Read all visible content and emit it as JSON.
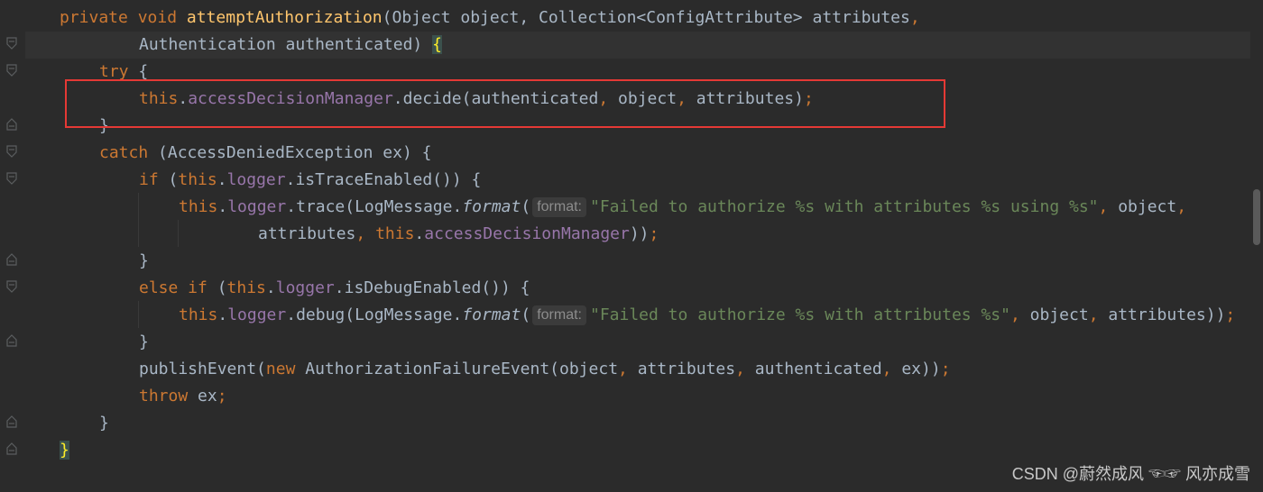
{
  "code": {
    "sig_private": "private",
    "sig_void": "void",
    "sig_method": "attemptAuthorization",
    "sig_params1": "(Object object, Collection<ConfigAttribute> attributes",
    "sig_comma": ",",
    "sig_params2": "Authentication authenticated) ",
    "sig_brace": "{",
    "try_kw": "try",
    "try_brace": " {",
    "decide_this": "this",
    "decide_dot": ".",
    "decide_field": "accessDecisionManager",
    "decide_call": ".decide(authenticated",
    "decide_c1": ",",
    "decide_obj": " object",
    "decide_c2": ",",
    "decide_attr": " attributes)",
    "decide_semi": ";",
    "close_try": "}",
    "catch_kw": "catch",
    "catch_rest": " (AccessDeniedException ex) {",
    "if_kw": "if",
    "if_open": " (",
    "if_this": "this",
    "if_dot": ".",
    "if_logger": "logger",
    "if_rest": ".isTraceEnabled()) {",
    "trace_this": "this",
    "trace_dot": ".",
    "trace_logger": "logger",
    "trace_call": ".trace(LogMessage.",
    "trace_format": "format",
    "trace_paren": "(",
    "trace_hint": "format:",
    "trace_str": "\"Failed to authorize %s with attributes %s using %s\"",
    "trace_c1": ",",
    "trace_obj": " object",
    "trace_c2": ",",
    "trace2_attr": "attributes",
    "trace2_c": ", ",
    "trace2_this": "this",
    "trace2_dot": ".",
    "trace2_field": "accessDecisionManager",
    "trace2_close": "))",
    "trace2_semi": ";",
    "close_if": "}",
    "else_kw": "else if",
    "else_open": " (",
    "else_this": "this",
    "else_dot": ".",
    "else_logger": "logger",
    "else_rest": ".isDebugEnabled()) {",
    "debug_this": "this",
    "debug_dot": ".",
    "debug_logger": "logger",
    "debug_call": ".debug(LogMessage.",
    "debug_format": "format",
    "debug_paren": "(",
    "debug_hint": "format:",
    "debug_str": "\"Failed to authorize %s with attributes %s\"",
    "debug_c1": ",",
    "debug_obj": " object",
    "debug_c2": ",",
    "debug_attr": " attributes))",
    "debug_semi": ";",
    "close_else": "}",
    "pub_call": "publishEvent(",
    "pub_new": "new",
    "pub_rest1": " AuthorizationFailureEvent(object",
    "pub_c1": ",",
    "pub_attr": " attributes",
    "pub_c2": ",",
    "pub_auth": " authenticated",
    "pub_c3": ",",
    "pub_ex": " ex))",
    "pub_semi": ";",
    "throw_kw": "throw",
    "throw_ex": " ex",
    "throw_semi": ";",
    "close_catch": "}",
    "close_method": "}"
  },
  "watermark": "CSDN @蔚然成风 ☜☞ 风亦成雪",
  "colors": {
    "background": "#2b2b2b",
    "keyword": "#cc7832",
    "method": "#ffc66d",
    "field": "#9876aa",
    "string": "#6a8759",
    "text": "#a9b7c6",
    "highlight_box": "#e53935"
  }
}
